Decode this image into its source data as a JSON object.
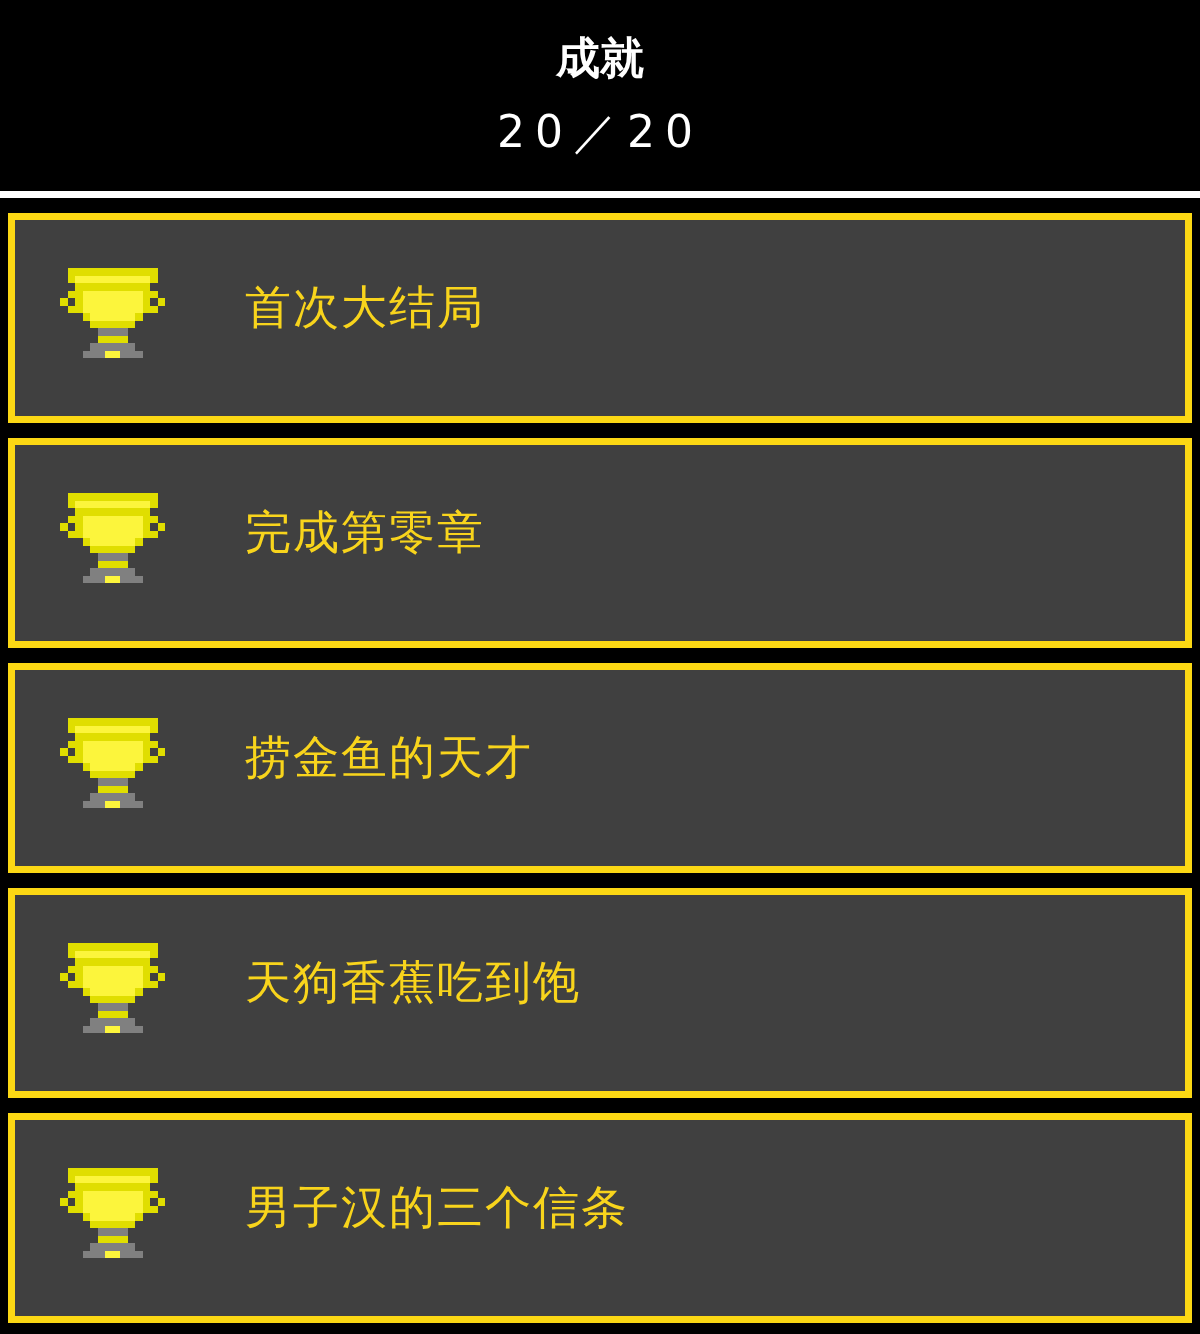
{
  "header": {
    "title": "成就",
    "progress": "20／20"
  },
  "achievements": [
    {
      "name": "首次大结局",
      "unlocked": true
    },
    {
      "name": "完成第零章",
      "unlocked": true
    },
    {
      "name": "捞金鱼的天才",
      "unlocked": true
    },
    {
      "name": "天狗香蕉吃到饱",
      "unlocked": true
    },
    {
      "name": "男子汉的三个信条",
      "unlocked": true
    }
  ]
}
